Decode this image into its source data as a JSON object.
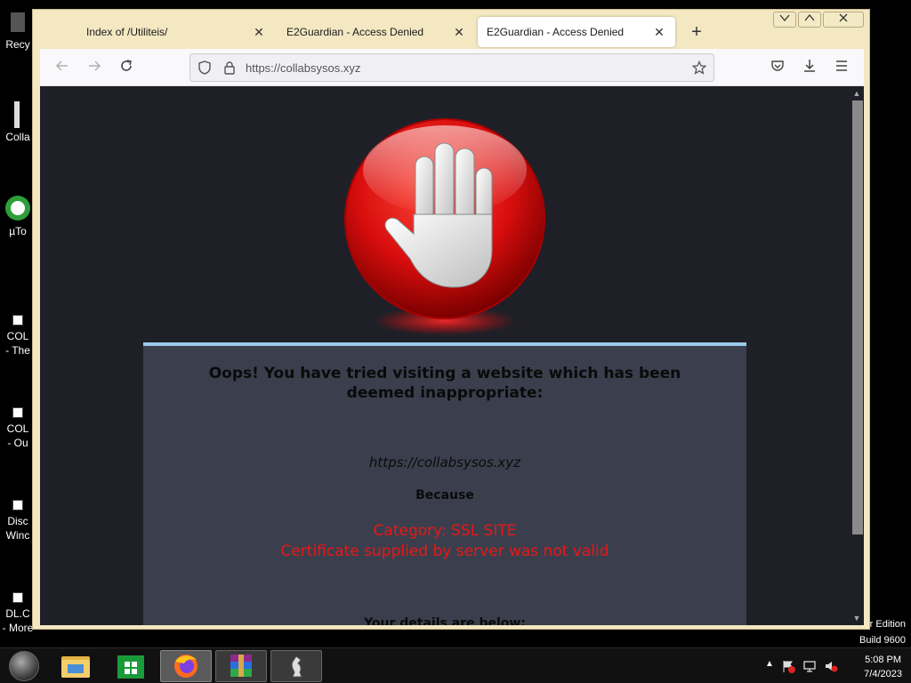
{
  "desktop": {
    "icons": [
      {
        "label": "Recy"
      },
      {
        "label": "Colla"
      },
      {
        "label": "µTo"
      },
      {
        "label": "COL",
        "label2": "- The"
      },
      {
        "label": "COL",
        "label2": "- Ou"
      },
      {
        "label": "Disc",
        "label2": "Winc"
      },
      {
        "label": "DL.C",
        "label2": "- More"
      }
    ],
    "watermark": {
      "line1": "r Edition",
      "line2": "Build 9600"
    }
  },
  "taskbar": {
    "apps": [
      {
        "icon": "file-explorer-icon"
      },
      {
        "icon": "store-icon"
      },
      {
        "icon": "firefox-icon"
      },
      {
        "icon": "winrar-icon"
      },
      {
        "icon": "chess-icon"
      }
    ],
    "clock": {
      "time": "5:08 PM",
      "date": "7/4/2023"
    }
  },
  "browser": {
    "tabs": [
      {
        "title": "Index of /Utiliteis/",
        "selected": false
      },
      {
        "title": "E2Guardian - Access Denied",
        "selected": false
      },
      {
        "title": "E2Guardian - Access Denied",
        "selected": true
      }
    ],
    "url": "https://collabsysos.xyz"
  },
  "page": {
    "headline": "Oops! You have tried visiting a website which has been deemed inappropriate:",
    "blocked_url": "https://collabsysos.xyz",
    "because": "Because",
    "category": "Category: SSL SITE",
    "reason": "Certificate supplied by server was not valid",
    "details": "Your details are below:"
  },
  "colors": {
    "page_bg": "#1f2027",
    "panel_bg": "#3b3f4d",
    "panel_border": "#9dc9ec",
    "reason_red": "#e81717"
  }
}
